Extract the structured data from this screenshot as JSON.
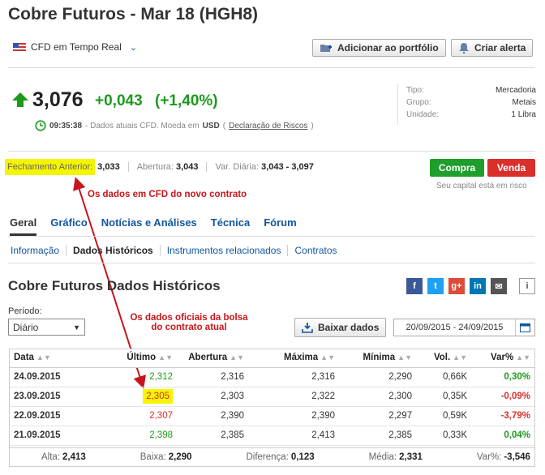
{
  "page": {
    "title": "Cobre Futuros - Mar 18 (HGH8)",
    "cfd_label": "CFD em Tempo Real"
  },
  "toolbar": {
    "portfolio_label": "Adicionar ao portfólio",
    "alert_label": "Criar alerta"
  },
  "quote": {
    "price": "3,076",
    "change": "+0,043",
    "change_pct": "(+1,40%)",
    "time": "09:35:38",
    "info_text": "- Dados atuais CFD. Moeda em",
    "currency": "USD",
    "paren_open": "(",
    "risk_link": "Declaração de Riscos",
    "paren_close": ")"
  },
  "meta": [
    {
      "label": "Tipo:",
      "value": "Mercadoria"
    },
    {
      "label": "Grupo:",
      "value": "Metais"
    },
    {
      "label": "Unidade:",
      "value": "1 Libra"
    }
  ],
  "stats": {
    "prev_close_label": "Fechamento Anterior:",
    "prev_close": "3,033",
    "open_label": "Abertura:",
    "open": "3,043",
    "range_label": "Var. Diária:",
    "range": "3,043 - 3,097"
  },
  "trade": {
    "buy": "Compra",
    "sell": "Venda",
    "risk_note": "Seu capital está em risco"
  },
  "annotations": {
    "top": "Os dados em CFD do novo contrato",
    "bottom_1": "Os dados oficiais da bolsa",
    "bottom_2": "do contrato atual"
  },
  "tabs": [
    "Geral",
    "Gráfico",
    "Notícias e Análises",
    "Técnica",
    "Fórum"
  ],
  "subtabs": [
    "Informação",
    "Dados Históricos",
    "Instrumentos relacionados",
    "Contratos"
  ],
  "section": {
    "title": "Cobre Futuros Dados Históricos",
    "period_label": "Período:",
    "period_value": "Diário",
    "download_label": "Baixar dados",
    "date_range": "20/09/2015 - 24/09/2015"
  },
  "share_icons": [
    "facebook-icon",
    "twitter-icon",
    "google-plus-icon",
    "linkedin-icon",
    "email-icon",
    "info-icon"
  ],
  "table": {
    "headers": [
      "Data",
      "Último",
      "Abertura",
      "Máxima",
      "Mínima",
      "Vol.",
      "Var%"
    ],
    "rows": [
      {
        "date": "24.09.2015",
        "last": "2,312",
        "open": "2,316",
        "high": "2,316",
        "low": "2,290",
        "vol": "0,66K",
        "chg": "0,30%"
      },
      {
        "date": "23.09.2015",
        "last": "2,305",
        "open": "2,303",
        "high": "2,322",
        "low": "2,300",
        "vol": "0,35K",
        "chg": "-0,09%"
      },
      {
        "date": "22.09.2015",
        "last": "2,307",
        "open": "2,390",
        "high": "2,390",
        "low": "2,297",
        "vol": "0,59K",
        "chg": "-3,79%"
      },
      {
        "date": "21.09.2015",
        "last": "2,398",
        "open": "2,385",
        "high": "2,413",
        "low": "2,385",
        "vol": "0,33K",
        "chg": "0,04%"
      }
    ],
    "summary": {
      "high_label": "Alta:",
      "high": "2,413",
      "low_label": "Baixa:",
      "low": "2,290",
      "diff_label": "Diferença:",
      "diff": "0,123",
      "avg_label": "Média:",
      "avg": "2,331",
      "chg_label": "Var%:",
      "chg": "-3,546"
    }
  },
  "colors": {
    "up": "#1d9a1d",
    "down": "#d9302c",
    "link": "#1256a0",
    "highlight": "#f6f500",
    "annotation": "#c8151b"
  }
}
